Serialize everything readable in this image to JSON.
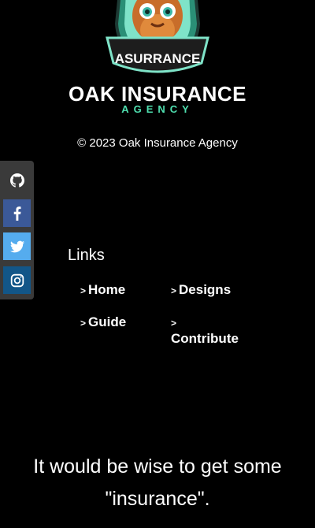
{
  "header": {
    "badge_text": "ASURRANCE",
    "brand_name": "OAK INSURANCE",
    "brand_sub": "AGENCY"
  },
  "footer": {
    "copyright": "© 2023 Oak Insurance Agency"
  },
  "social": [
    {
      "icon": "github-icon",
      "color": "#3a3a3a"
    },
    {
      "icon": "facebook-icon",
      "color": "#3b5998"
    },
    {
      "icon": "twitter-icon",
      "color": "#55acee"
    },
    {
      "icon": "instagram-icon",
      "color": "#125688"
    }
  ],
  "links": {
    "title": "Links",
    "chevron": ">",
    "items": [
      {
        "label": "Home"
      },
      {
        "label": "Designs"
      },
      {
        "label": "Guide"
      },
      {
        "label": "Contribute"
      }
    ]
  },
  "tagline": "It would be wise to get some \"insurance\".",
  "colors": {
    "accent": "#4fe0b0",
    "background": "#000000"
  }
}
